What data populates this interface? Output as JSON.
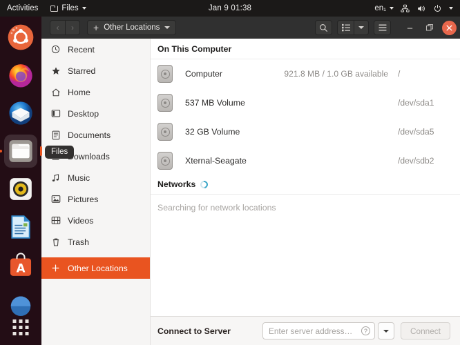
{
  "topbar": {
    "activities": "Activities",
    "app_menu": "Files",
    "clock": "Jan 9  01:38",
    "language": "en₁",
    "icons": [
      "network-icon",
      "volume-icon",
      "power-icon",
      "chevron-down-icon"
    ]
  },
  "dock": {
    "items": [
      {
        "name": "ubuntu-logo",
        "label": "Ubuntu"
      },
      {
        "name": "firefox",
        "label": "Firefox"
      },
      {
        "name": "thunderbird",
        "label": "Thunderbird"
      },
      {
        "name": "files",
        "label": "Files"
      },
      {
        "name": "rhythmbox",
        "label": "Rhythmbox"
      },
      {
        "name": "libreoffice-writer",
        "label": "LibreOffice Writer"
      },
      {
        "name": "ubuntu-software",
        "label": "Ubuntu Software"
      },
      {
        "name": "help",
        "label": "Help"
      }
    ],
    "show_apps": "Show Applications"
  },
  "headerbar": {
    "back": "‹",
    "forward": "›",
    "path_label": "Other Locations",
    "plus": "+",
    "search": "search-icon",
    "view_list": "list-view-icon",
    "view_dropdown": "chevron-down-icon",
    "menu": "hamburger-menu-icon",
    "minimize": "–",
    "maximize": "❐",
    "close": "✕"
  },
  "sidebar": {
    "items": [
      {
        "label": "Recent",
        "icon": "clock-icon",
        "glyph": "◷",
        "selected": false
      },
      {
        "label": "Starred",
        "icon": "star-icon",
        "glyph": "★",
        "selected": false
      },
      {
        "label": "Home",
        "icon": "home-icon",
        "glyph": "⌂",
        "selected": false
      },
      {
        "label": "Desktop",
        "icon": "desktop-icon",
        "glyph": "▧",
        "selected": false
      },
      {
        "label": "Documents",
        "icon": "documents-icon",
        "glyph": "▤",
        "selected": false
      },
      {
        "label": "Downloads",
        "icon": "download-icon",
        "glyph": "↓",
        "selected": false
      },
      {
        "label": "Music",
        "icon": "music-icon",
        "glyph": "♫",
        "selected": false
      },
      {
        "label": "Pictures",
        "icon": "pictures-icon",
        "glyph": "▣",
        "selected": false
      },
      {
        "label": "Videos",
        "icon": "video-icon",
        "glyph": "⊟",
        "selected": false
      },
      {
        "label": "Trash",
        "icon": "trash-icon",
        "glyph": "⌦",
        "selected": false
      },
      {
        "label": "Other Locations",
        "icon": "plus-icon",
        "glyph": "+",
        "selected": true
      }
    ],
    "tooltip": "Files"
  },
  "content": {
    "section_computer": "On This Computer",
    "section_networks": "Networks",
    "drives": [
      {
        "name": "Computer",
        "info": "921.8 MB / 1.0 GB available",
        "path": "/"
      },
      {
        "name": "537 MB Volume",
        "info": "",
        "path": "/dev/sda1"
      },
      {
        "name": "32 GB Volume",
        "info": "",
        "path": "/dev/sda5"
      },
      {
        "name": "Xternal-Seagate",
        "info": "",
        "path": "/dev/sdb2"
      }
    ],
    "network_status": "Searching for network locations"
  },
  "connect": {
    "label": "Connect to Server",
    "placeholder": "Enter server address…",
    "value": "",
    "help": "?",
    "button": "Connect"
  },
  "colors": {
    "accent": "#e95420",
    "close_button": "#e8674c",
    "topbar_bg": "#1b1918",
    "headerbar_bg": "#303030",
    "sidebar_bg": "#f6f5f4",
    "spinner": "#3aa6c8"
  }
}
